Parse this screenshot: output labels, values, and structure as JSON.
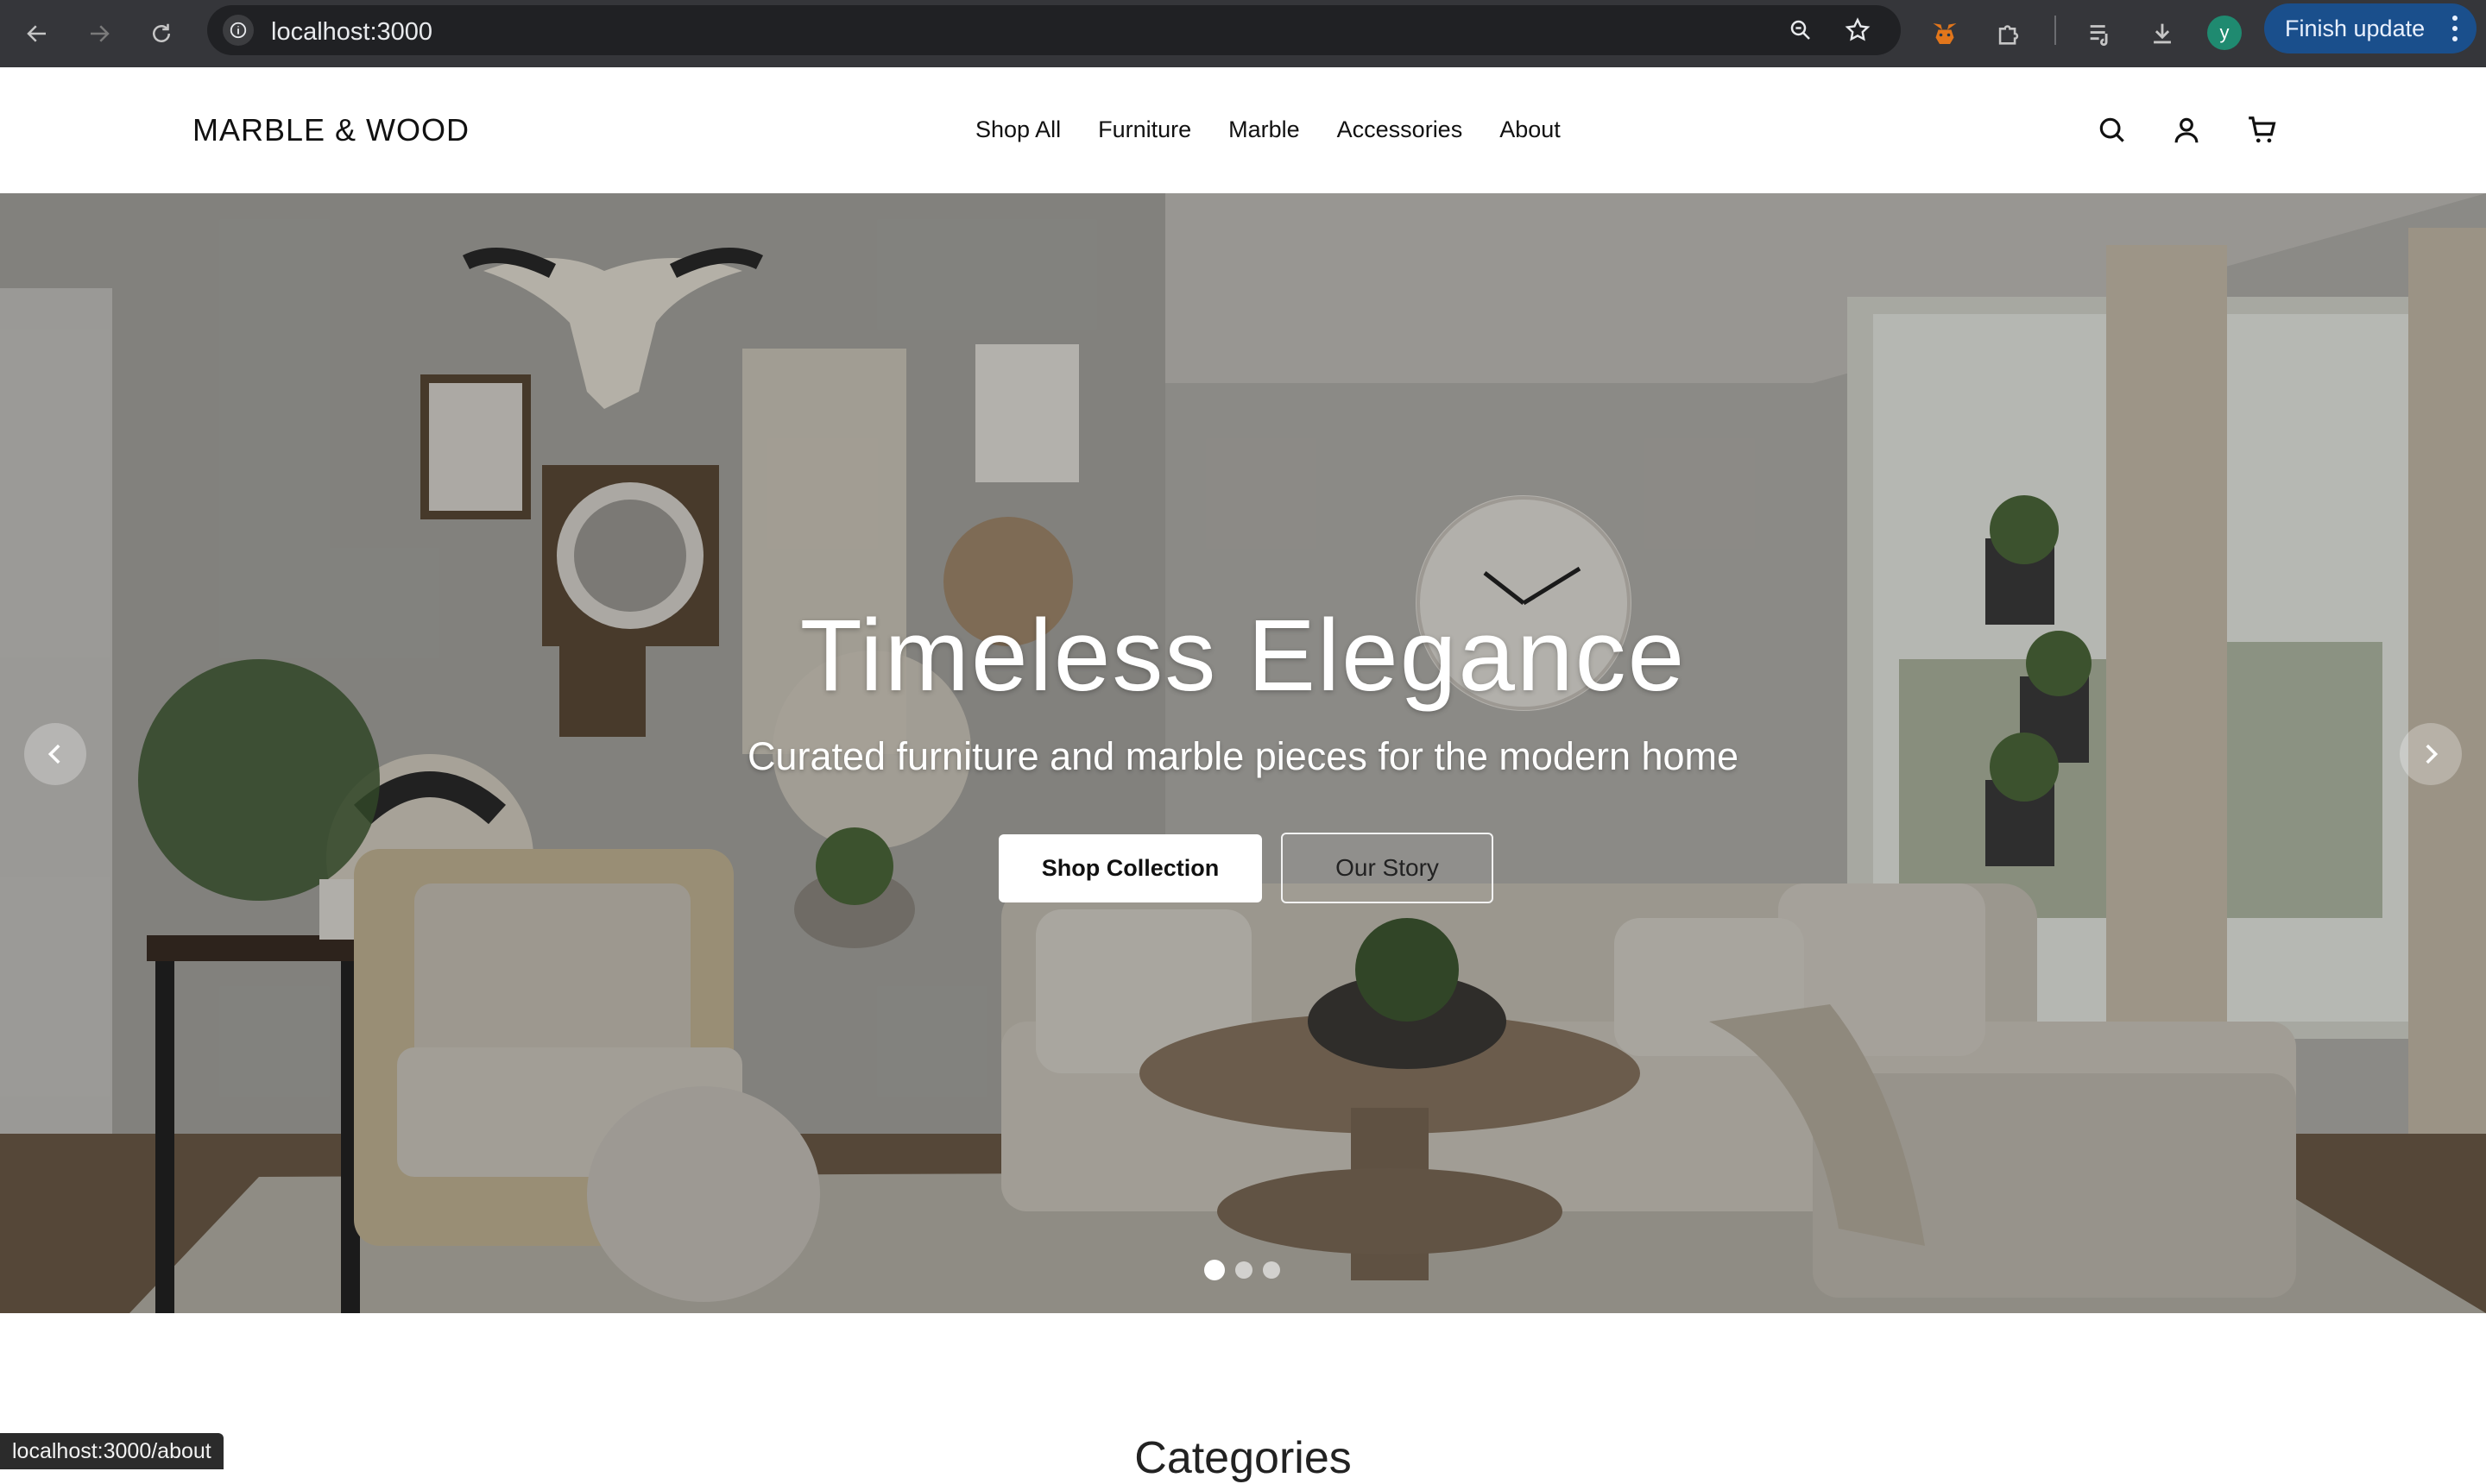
{
  "browser": {
    "url": "localhost:3000",
    "profile_initial": "y",
    "finish_update_label": "Finish update",
    "icons": [
      "back-icon",
      "forward-icon",
      "reload-icon",
      "site-info-icon",
      "zoom-icon",
      "bookmark-star-icon",
      "metamask-fox-icon",
      "extensions-puzzle-icon",
      "media-queue-icon",
      "download-icon",
      "menu-dots-icon"
    ]
  },
  "header": {
    "brand": "MARBLE & WOOD",
    "nav": [
      "Shop All",
      "Furniture",
      "Marble",
      "Accessories",
      "About"
    ],
    "icons": [
      "search-icon",
      "user-icon",
      "cart-icon"
    ]
  },
  "hero": {
    "title": "Timeless Elegance",
    "subtitle": "Curated furniture and marble pieces for the modern home",
    "primary_button": "Shop Collection",
    "secondary_button": "Our Story",
    "slides_total": 3,
    "active_slide": 1
  },
  "sections": {
    "categories_title": "Categories"
  },
  "status_bar": {
    "link": "localhost:3000/about"
  },
  "colors": {
    "chrome_bg": "#35363a",
    "omnibox_bg": "#202124",
    "finish_button_bg": "#1a4f8c",
    "accent_text": "#111111"
  }
}
